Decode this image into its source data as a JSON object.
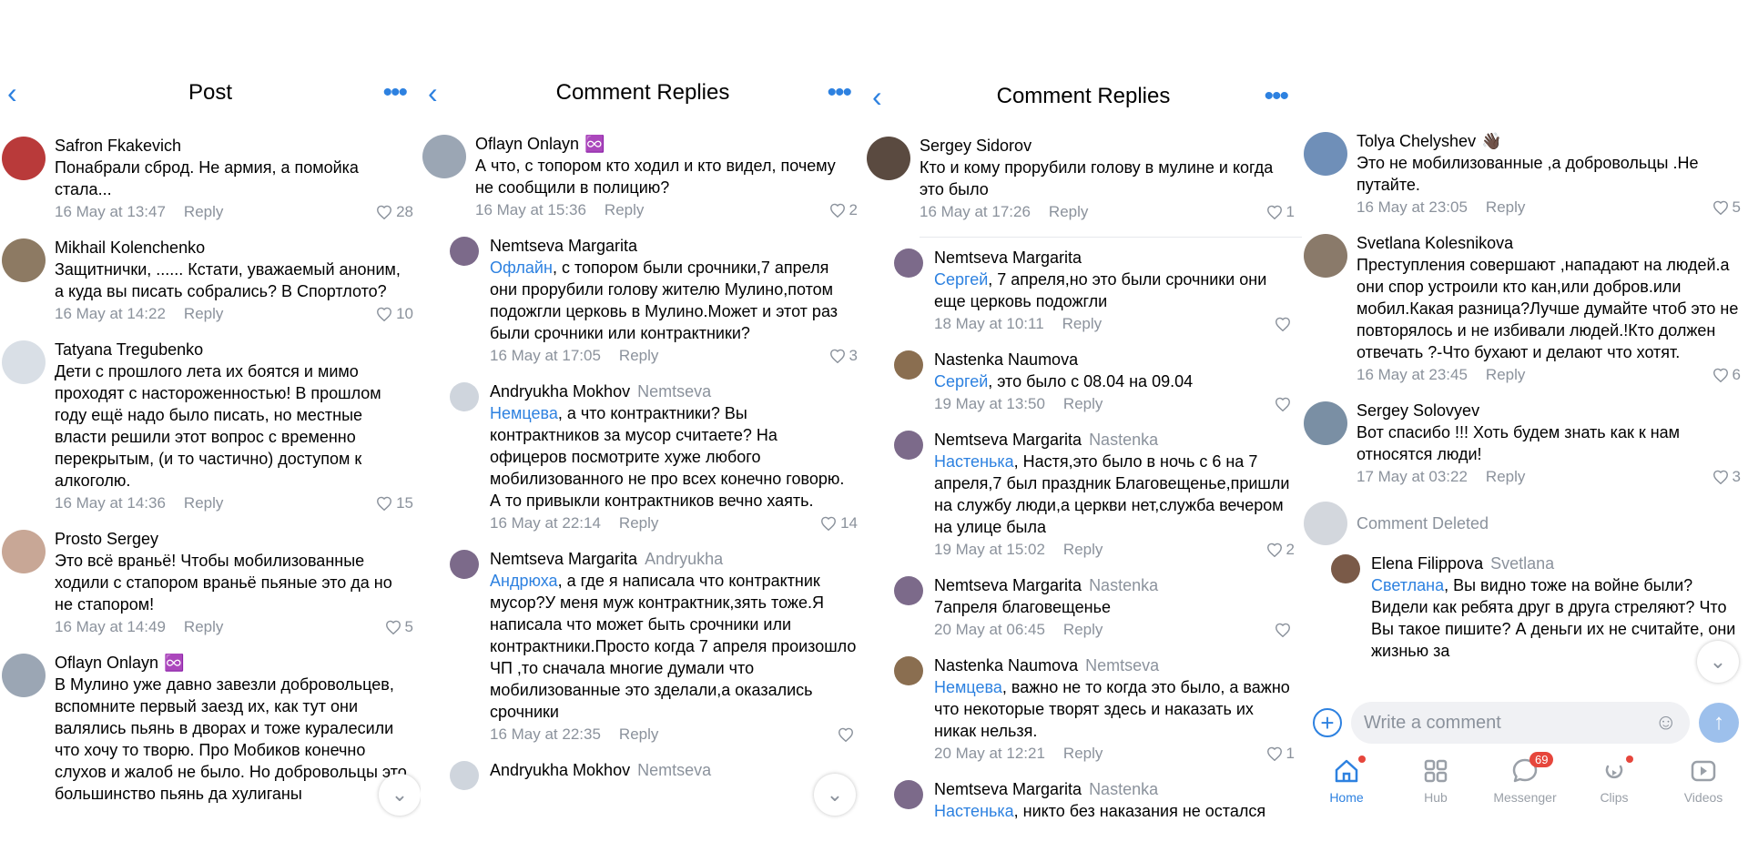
{
  "panel1": {
    "title": "Post",
    "comments": [
      {
        "name": "Safron Fkakevich",
        "text": "Понабрали сброд. Не армия, а помойка стала...",
        "time": "16 May at 13:47",
        "reply": "Reply",
        "likes": "28",
        "avatar_color": "#b93a3a"
      },
      {
        "name": "Mikhail Kolenchenko",
        "text": "Защитнички, ...... Кстати, уважаемый аноним, а куда вы писать собрались? В Спортлото?",
        "time": "16 May at 14:22",
        "reply": "Reply",
        "likes": "10",
        "avatar_color": "#8d7a63"
      },
      {
        "name": "Tatyana Tregubenko",
        "text": "Дети с прошлого лета их боятся и мимо проходят с настороженностью! В прошлом году ещё надо было писать, но местные власти решили этот вопрос с временно перекрытым, (и то частично) доступом к алкоголю.",
        "time": "16 May at 14:36",
        "reply": "Reply",
        "likes": "15",
        "avatar_color": "#d9dfe6"
      },
      {
        "name": "Prosto Sergey",
        "text": "Это всё враньё! Чтобы мобилизованные ходили с стапором враньё пьяные это да но не стапором!",
        "time": "16 May at 14:49",
        "reply": "Reply",
        "likes": "5",
        "avatar_color": "#c8a796"
      },
      {
        "name": "Oflayn Onlayn",
        "emoji": "♾️",
        "text": "В Мулино уже давно завезли добровольцев, вспомните первый заезд их, как тут они валялись пьянь в дворах и тоже куралесили что хочу то творю.  Про Мобиков конечно слухов и жалоб не было. Но добровольцы это большинство пьянь да хулиганы",
        "avatar_color": "#9ba6b4"
      }
    ]
  },
  "panel2": {
    "title": "Comment Replies",
    "main": {
      "name": "Oflayn Onlayn",
      "emoji": "♾️",
      "text": "А что, с топором кто ходил и кто видел, почему не сообщили в полицию?",
      "time": "16 May at 15:36",
      "reply": "Reply",
      "likes": "2",
      "avatar_color": "#9ba6b4"
    },
    "replies": [
      {
        "name": "Nemtseva Margarita",
        "to": "",
        "mention": "Офлайн",
        "text": ", с топором были срочники,7 апреля они прорубили голову жителю Мулино,потом подожгли церковь в Мулино.Может и этот раз были срочники или контрактники?",
        "time": "16 May at 17:05",
        "reply": "Reply",
        "likes": "3",
        "avatar_color": "#7c6a8a"
      },
      {
        "name": "Andryukha Mokhov",
        "to": "Nemtseva",
        "mention": "Немцева",
        "text": ", а что контрактники? Вы контрактников за мусор считаете? На офицеров посмотрите хуже любого мобилизованного не про всех конечно говорю. А то привыкли контрактников вечно хаять.",
        "time": "16 May at 22:14",
        "reply": "Reply",
        "likes": "14",
        "avatar_color": "#cfd5dd"
      },
      {
        "name": "Nemtseva Margarita",
        "to": "Andryukha",
        "mention": "Андрюха",
        "text": ", а где я написала что контрактник мусор?У меня муж контрактник,зять тоже.Я написала что может быть срочники или контрактники.Просто когда 7 апреля произошло ЧП ,то сначала многие думали что мобилизованные это зделали,а оказались срочники",
        "time": "16 May at 22:35",
        "reply": "Reply",
        "likes": "",
        "avatar_color": "#7c6a8a"
      },
      {
        "name": "Andryukha Mokhov",
        "to": "Nemtseva",
        "mention": "",
        "text": "",
        "avatar_color": "#cfd5dd"
      }
    ]
  },
  "panel3": {
    "title": "Comment Replies",
    "main": {
      "name": "Sergey Sidorov",
      "text": "Кто и кому  прорубили голову в мулине и когда это было",
      "time": "16 May at 17:26",
      "reply": "Reply",
      "likes": "1",
      "avatar_color": "#5a4a40"
    },
    "replies": [
      {
        "name": "Nemtseva Margarita",
        "to": "",
        "mention": "Сергей",
        "text": ", 7 апреля,но это были срочники они еще церковь подожгли",
        "time": "18 May at 10:11",
        "reply": "Reply",
        "likes": "",
        "avatar_color": "#7c6a8a"
      },
      {
        "name": "Nastenka Naumova",
        "to": "",
        "mention": "Сергей",
        "text": ", это было с 08.04 на 09.04",
        "time": "19 May at 13:50",
        "reply": "Reply",
        "likes": "",
        "avatar_color": "#8a6e50"
      },
      {
        "name": "Nemtseva Margarita",
        "to": "Nastenka",
        "mention": "Настенька",
        "text": ", Настя,это было в ночь с 6 на 7 апреля,7 был праздник Благовещенье,пришли на службу люди,а церкви нет,служба вечером на улице была",
        "time": "19 May at 15:02",
        "reply": "Reply",
        "likes": "2",
        "avatar_color": "#7c6a8a"
      },
      {
        "name": "Nemtseva Margarita",
        "to": "Nastenka",
        "mention": "",
        "text": "7апреля благовещенье",
        "time": "20 May at 06:45",
        "reply": "Reply",
        "likes": "",
        "avatar_color": "#7c6a8a"
      },
      {
        "name": "Nastenka Naumova",
        "to": "Nemtseva",
        "mention": "Немцева",
        "text": ", важно не то когда это было, а важно что некоторые творят здесь и наказать их никак нельзя.",
        "time": "20 May at 12:21",
        "reply": "Reply",
        "likes": "1",
        "avatar_color": "#8a6e50"
      },
      {
        "name": "Nemtseva Margarita",
        "to": "Nastenka",
        "mention": "Настенька",
        "text": ", никто без наказания не остался",
        "avatar_color": "#7c6a8a"
      }
    ]
  },
  "panel4": {
    "comments": [
      {
        "name": "Tolya Chelyshev",
        "emoji": "👋🏿",
        "text": "Это не мобилизованные ,а добровольцы .Не путайте.",
        "time": "16 May at 23:05",
        "reply": "Reply",
        "likes": "5",
        "avatar_color": "#6f8fb8"
      },
      {
        "name": "Svetlana Kolesnikova",
        "text": "Преступления совершают ,нападают на людей.а они спор устроили кто кан,или добров.или мобил.Какая разница?Лучше думайте чтоб это не повторялось и не избивали людей.!Кто должен отвечать ?-Что бухают и делают что хотят.",
        "time": "16 May at 23:45",
        "reply": "Reply",
        "likes": "6",
        "avatar_color": "#8a7a6a"
      },
      {
        "name": "Sergey Solovyev",
        "text": "Вот спасибо !!! Хоть будем знать как к нам относятся люди!",
        "time": "17 May at 03:22",
        "reply": "Reply",
        "likes": "3",
        "avatar_color": "#7a8fa4"
      }
    ],
    "deleted_text": "Comment Deleted",
    "reply": {
      "name": "Elena Filippova",
      "to": "Svetlana",
      "mention": "Светлана",
      "text": ", Вы видно тоже на войне были? Видели как ребята друг в друга стреляют? Что Вы такое пишите? А деньги их не считайте, они жизнью за",
      "avatar_color": "#7a5a48"
    },
    "composer_placeholder": "Write a comment",
    "tabs": [
      {
        "label": "Home",
        "icon": "home-icon",
        "active": true,
        "dot": true
      },
      {
        "label": "Hub",
        "icon": "hub-icon"
      },
      {
        "label": "Messenger",
        "icon": "messenger-icon",
        "badge": "69"
      },
      {
        "label": "Clips",
        "icon": "clips-icon",
        "dot": true
      },
      {
        "label": "Videos",
        "icon": "videos-icon"
      }
    ]
  },
  "colors": {
    "accent": "#2d81e0",
    "muted": "#8b929c",
    "badge": "#e6463c"
  }
}
